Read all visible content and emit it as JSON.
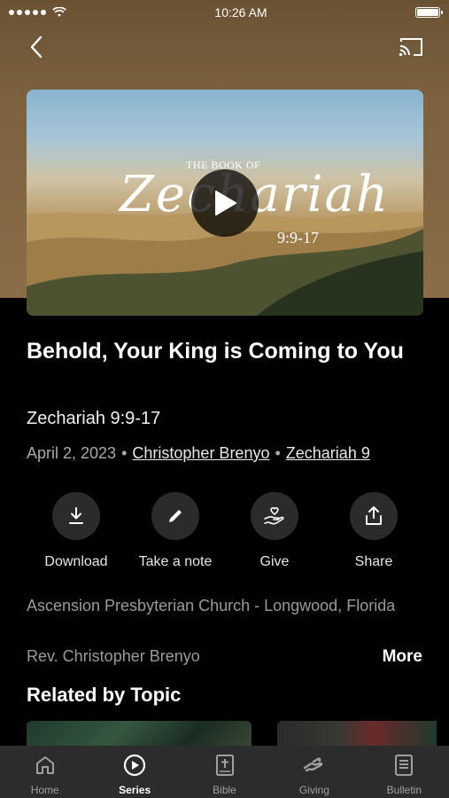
{
  "status_bar": {
    "time": "10:26 AM"
  },
  "video": {
    "title_small": "THE BOOK OF",
    "title_script": "Zechariah",
    "reference": "9:9-17"
  },
  "sermon": {
    "title": "Behold, Your King is Coming to You",
    "scripture": "Zechariah 9:9-17",
    "date": "April 2, 2023",
    "speaker": "Christopher Brenyo",
    "book_link": "Zechariah 9"
  },
  "actions": [
    {
      "label": "Download",
      "icon": "download-icon"
    },
    {
      "label": "Take a note",
      "icon": "pencil-icon"
    },
    {
      "label": "Give",
      "icon": "heart-hand-icon"
    },
    {
      "label": "Share",
      "icon": "share-icon"
    }
  ],
  "details": {
    "church": "Ascension Presbyterian Church - Longwood, Florida",
    "pastor": "Rev. Christopher Brenyo",
    "more_label": "More"
  },
  "related": {
    "title": "Related by Topic"
  },
  "tabs": [
    {
      "label": "Home",
      "icon": "home-icon",
      "active": false
    },
    {
      "label": "Series",
      "icon": "play-circle-icon",
      "active": true
    },
    {
      "label": "Bible",
      "icon": "bible-icon",
      "active": false
    },
    {
      "label": "Giving",
      "icon": "giving-icon",
      "active": false
    },
    {
      "label": "Bulletin",
      "icon": "bulletin-icon",
      "active": false
    }
  ],
  "colors": {
    "background": "#000000",
    "hero": "#7c6240",
    "tab_bar": "#2c2c2c",
    "action_circle": "#2b2b2b"
  }
}
